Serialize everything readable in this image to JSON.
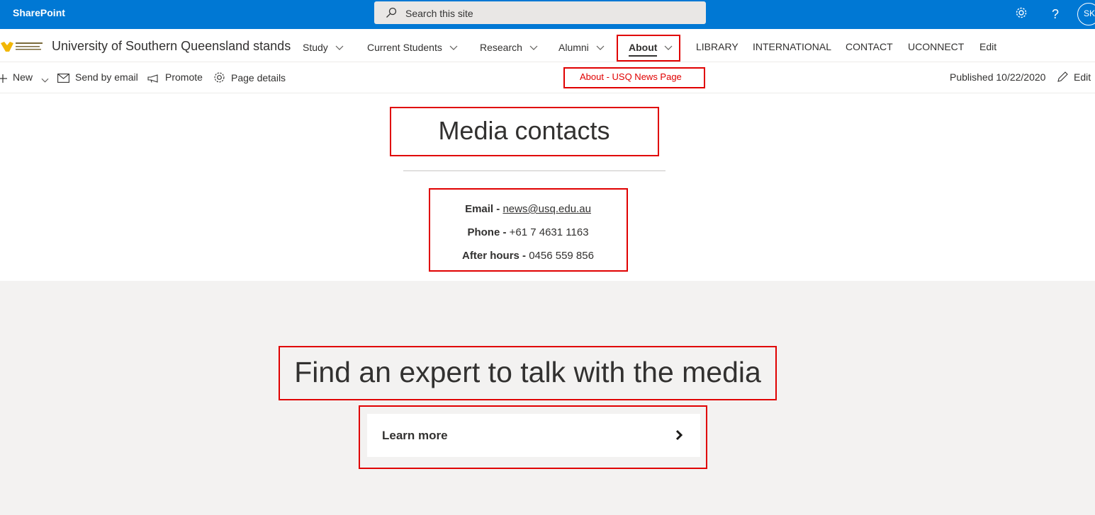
{
  "suite": {
    "brand": "SharePoint",
    "search_placeholder": "Search this site",
    "help_glyph": "?",
    "user_initials": "SK"
  },
  "site": {
    "title": "University of Southern Queensland stands",
    "nav": [
      {
        "label": "Study",
        "dropdown": true
      },
      {
        "label": "Current Students",
        "dropdown": true
      },
      {
        "label": "Research",
        "dropdown": true
      },
      {
        "label": "Alumni",
        "dropdown": true
      },
      {
        "label": "About",
        "dropdown": true,
        "selected": true
      },
      {
        "label": "LIBRARY"
      },
      {
        "label": "INTERNATIONAL"
      },
      {
        "label": "CONTACT"
      },
      {
        "label": "UCONNECT"
      },
      {
        "label": "Edit"
      }
    ]
  },
  "commandbar": {
    "new_label": "New",
    "send_email_label": "Send by email",
    "promote_label": "Promote",
    "page_details_label": "Page details",
    "page_label": "About - USQ News Page",
    "published": "Published 10/22/2020",
    "edit_label": "Edit"
  },
  "content": {
    "heading": "Media contacts",
    "contacts": [
      {
        "label": "Email - ",
        "value": "news@usq.edu.au",
        "is_link": true
      },
      {
        "label": "Phone - ",
        "value": "+61 7 4631 1163"
      },
      {
        "label": "After hours - ",
        "value": "0456 559 856"
      }
    ],
    "expert_heading": "Find an expert to talk with the media",
    "learn_more": "Learn more"
  },
  "colors": {
    "suitebar": "#0078d4",
    "highlight": "#e00000",
    "section_bg": "#f3f2f1"
  }
}
